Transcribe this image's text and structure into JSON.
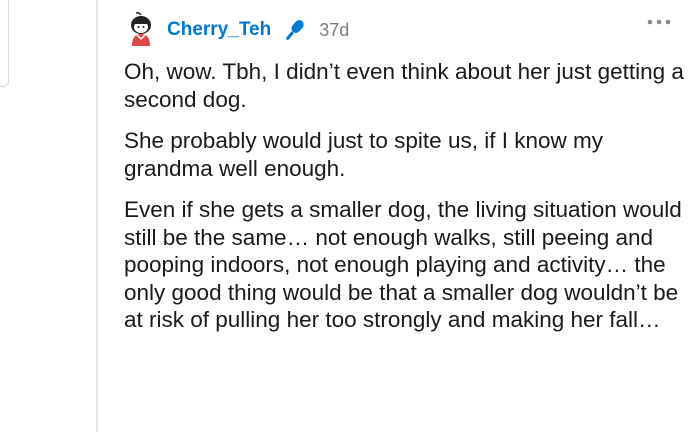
{
  "comment": {
    "author": "Cherry_Teh",
    "author_icon": "microphone-icon",
    "age": "37d",
    "menu_icon": "more-options-icon",
    "paragraphs": [
      "Oh, wow. Tbh, I didn’t even think about her just getting a second dog.",
      "She probably would just to spite us, if I know my grandma well enough.",
      "Even if she gets a smaller dog, the living situation would still be the same… not enough walks, still peeing and pooping indoors, not enough playing and activity… the only good thing would be that a smaller dog wouldn’t be at risk of pulling her too strongly and making her fall…"
    ]
  },
  "colors": {
    "username": "#0079d3",
    "timestamp": "#787c7e",
    "text": "#1a1a1b"
  }
}
